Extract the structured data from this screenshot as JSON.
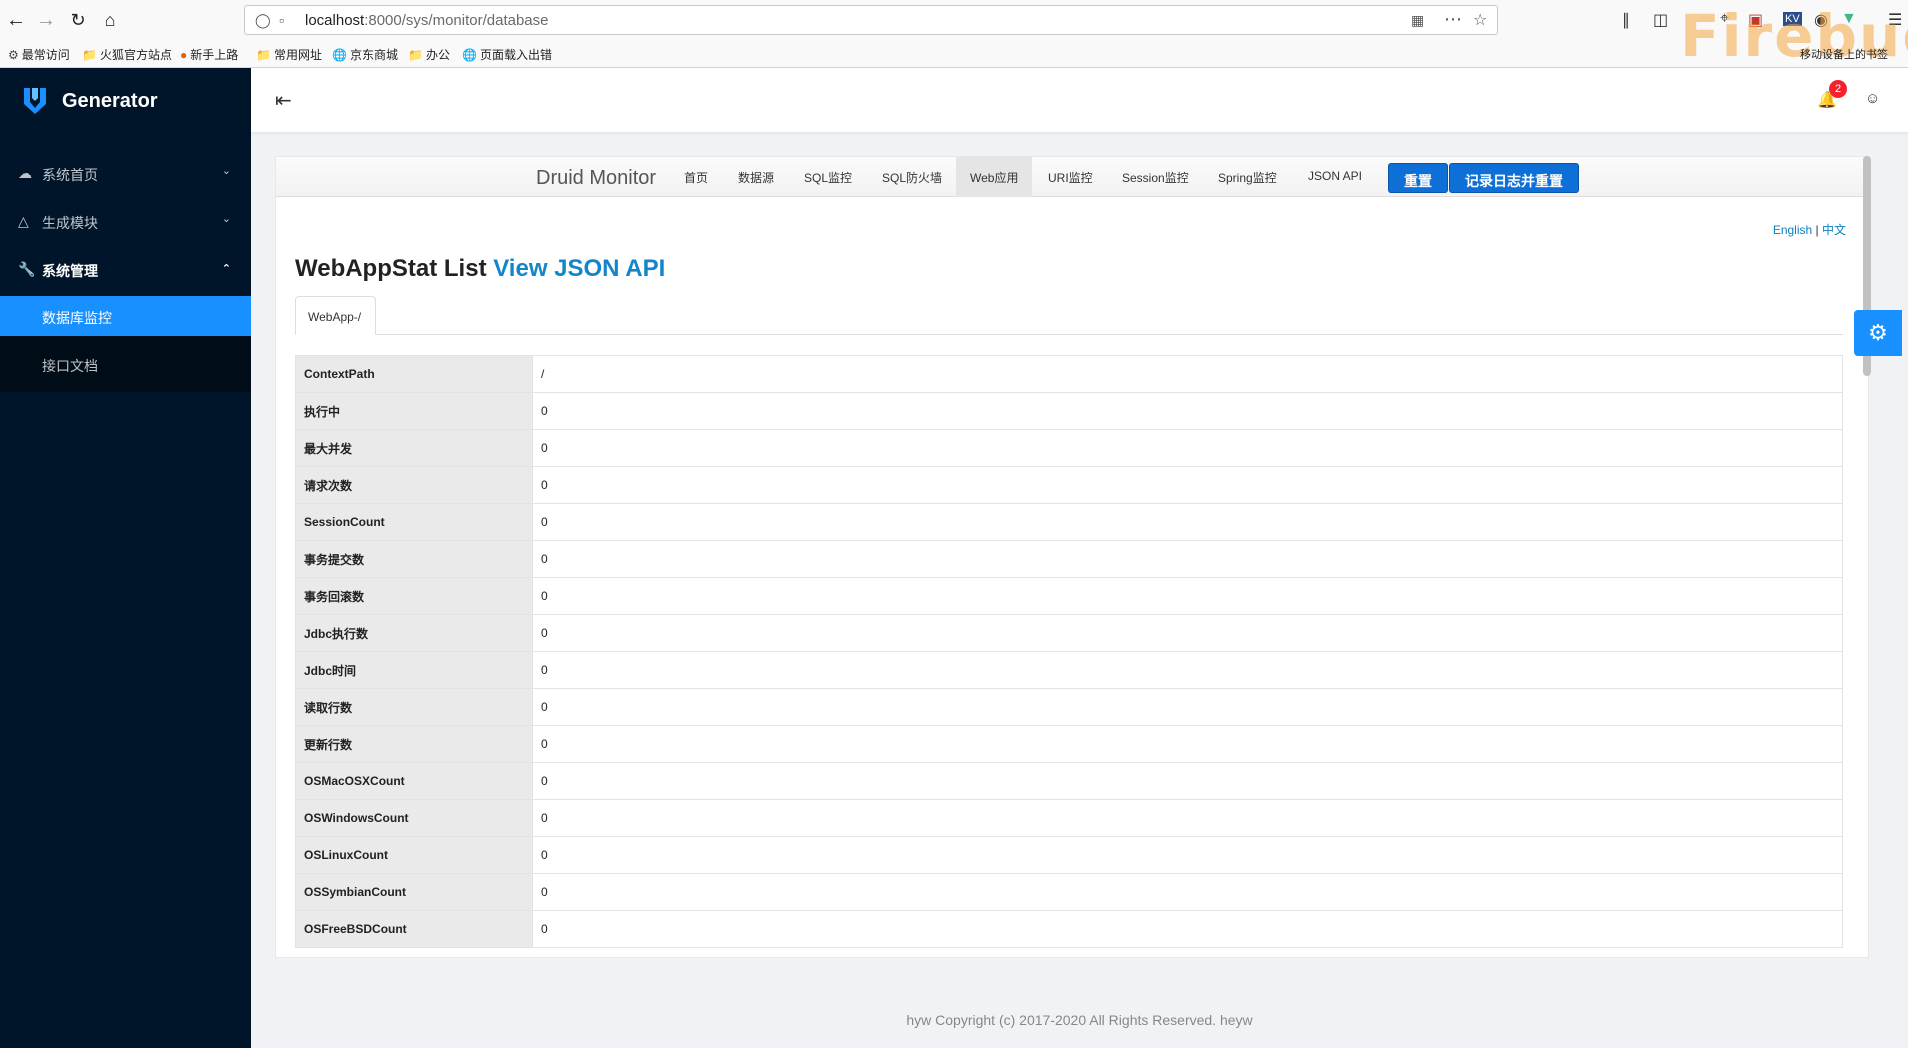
{
  "browser": {
    "url_host": "localhost",
    "url_path": ":8000/sys/monitor/database",
    "bookmarks": [
      "最常访问",
      "火狐官方站点",
      "新手上路",
      "常用网址",
      "京东商城",
      "办公",
      "页面载入出错"
    ],
    "mobile_bookmarks": "移动设备上的书签",
    "firebug_watermark": "Firebug"
  },
  "sidebar": {
    "logo": "Generator",
    "menu": [
      {
        "label": "系统首页",
        "icon": "cloud-icon"
      },
      {
        "label": "生成模块",
        "icon": "cluster-icon"
      },
      {
        "label": "系统管理",
        "icon": "tool-icon"
      }
    ],
    "submenu": [
      {
        "label": "数据库监控",
        "active": true
      },
      {
        "label": "接口文档",
        "active": false
      }
    ]
  },
  "header": {
    "notification_count": "2"
  },
  "druid": {
    "brand": "Druid Monitor",
    "nav": [
      "首页",
      "数据源",
      "SQL监控",
      "SQL防火墙",
      "Web应用",
      "URI监控",
      "Session监控",
      "Spring监控",
      "JSON API"
    ],
    "active_nav": "Web应用",
    "reset_button": "重置",
    "log_reset_button": "记录日志并重置",
    "lang_en": "English",
    "lang_sep": "|",
    "lang_zh": "中文",
    "title": "WebAppStat List",
    "title_link": "View JSON API",
    "tab": "WebApp-/",
    "rows": [
      {
        "key": "ContextPath",
        "value": "/"
      },
      {
        "key": "执行中",
        "value": "0"
      },
      {
        "key": "最大并发",
        "value": "0"
      },
      {
        "key": "请求次数",
        "value": "0"
      },
      {
        "key": "SessionCount",
        "value": "0"
      },
      {
        "key": "事务提交数",
        "value": "0"
      },
      {
        "key": "事务回滚数",
        "value": "0"
      },
      {
        "key": "Jdbc执行数",
        "value": "0"
      },
      {
        "key": "Jdbc时间",
        "value": "0"
      },
      {
        "key": "读取行数",
        "value": "0"
      },
      {
        "key": "更新行数",
        "value": "0"
      },
      {
        "key": "OSMacOSXCount",
        "value": "0"
      },
      {
        "key": "OSWindowsCount",
        "value": "0"
      },
      {
        "key": "OSLinuxCount",
        "value": "0"
      },
      {
        "key": "OSSymbianCount",
        "value": "0"
      },
      {
        "key": "OSFreeBSDCount",
        "value": "0"
      }
    ]
  },
  "footer": "hyw Copyright (c) 2017-2020 All Rights Reserved. heyw"
}
